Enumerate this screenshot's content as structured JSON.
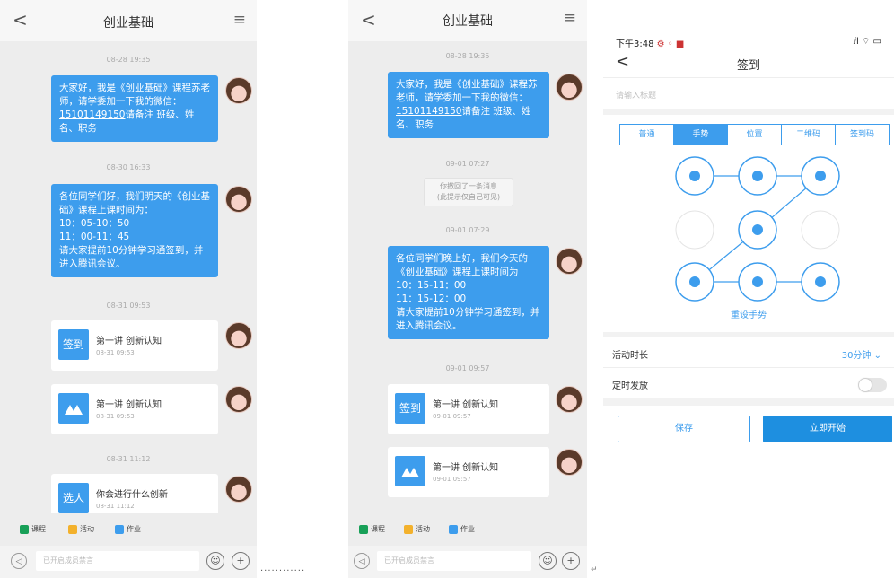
{
  "left": {
    "title": "创业基础",
    "back_glyph": "<",
    "menu_glyph": "≡",
    "messages": [
      {
        "time": "08-28 19:35",
        "html": "大家好，我是《创业基础》课程苏老师，请学委加一下我的微信：",
        "link": "15101149150",
        "tail": "请备注 班级、姓名、职务"
      },
      {
        "time": "08-30 16:33",
        "text": "各位同学们好，我们明天的《创业基础》课程上课时间为：\n10：05-10：50\n11：00-11：45\n请大家提前10分钟学习通签到，并进入腾讯会议。"
      },
      {
        "time": "08-31 09:53",
        "card_icon": "签到",
        "card_title": "第一讲 创新认知",
        "card_date": "08-31 09:53"
      },
      {
        "card_icon": "M",
        "card_title": "第一讲 创新认知",
        "card_date": "08-31 09:53"
      },
      {
        "time": "08-31 11:12",
        "card_icon": "选人",
        "card_title": "你会进行什么创新",
        "card_date": "08-31 11:12"
      }
    ],
    "toolbar": [
      "课程",
      "活动",
      "作业"
    ],
    "input_placeholder": "已开启成员禁言"
  },
  "middle": {
    "title": "创业基础",
    "back_glyph": "<",
    "menu_glyph": "≡",
    "msg1": {
      "time": "08-28 19:35",
      "html": "大家好，我是《创业基础》课程苏老师，请学委加一下我的微信：",
      "link": "15101149150",
      "tail": "请备注 班级、姓名、职务"
    },
    "sys": {
      "time": "09-01 07:27",
      "text1": "你撤回了一条消息",
      "text2": "(此提示仅自己可见)"
    },
    "msg2": {
      "time": "09-01 07:29",
      "text": "各位同学们晚上好，我们今天的《创业基础》课程上课时间为\n10：15-11：00\n11：15-12：00\n请大家提前10分钟学习通签到，并进入腾讯会议。"
    },
    "card1": {
      "time": "09-01 09:57",
      "icon": "签到",
      "title": "第一讲 创新认知",
      "date": "09-01 09:57"
    },
    "card2": {
      "icon": "M",
      "title": "第一讲 创新认知",
      "date": "09-01 09:57"
    },
    "toolbar": [
      "课程",
      "活动",
      "作业"
    ],
    "input_placeholder": "已开启成员禁言"
  },
  "right": {
    "status_time": "下午3:48",
    "status_icons": "⚙ ◦ ■",
    "status_right": "ⅈl ⌔ ▭",
    "back_glyph": "<",
    "title": "签到",
    "title_placeholder": "请输入标题",
    "tabs": [
      "普通",
      "手势",
      "位置",
      "二维码",
      "签到码"
    ],
    "active_tab": 1,
    "reset_label": "重设手势",
    "duration_label": "活动时长",
    "duration_value": "30分钟 ⌄",
    "schedule_label": "定时发放",
    "save_label": "保存",
    "start_label": "立即开始"
  },
  "ellipsis": "............",
  "cursor_mark": "↵",
  "colors": {
    "accent": "#3d9ded",
    "chat_bg": "#ededed"
  }
}
